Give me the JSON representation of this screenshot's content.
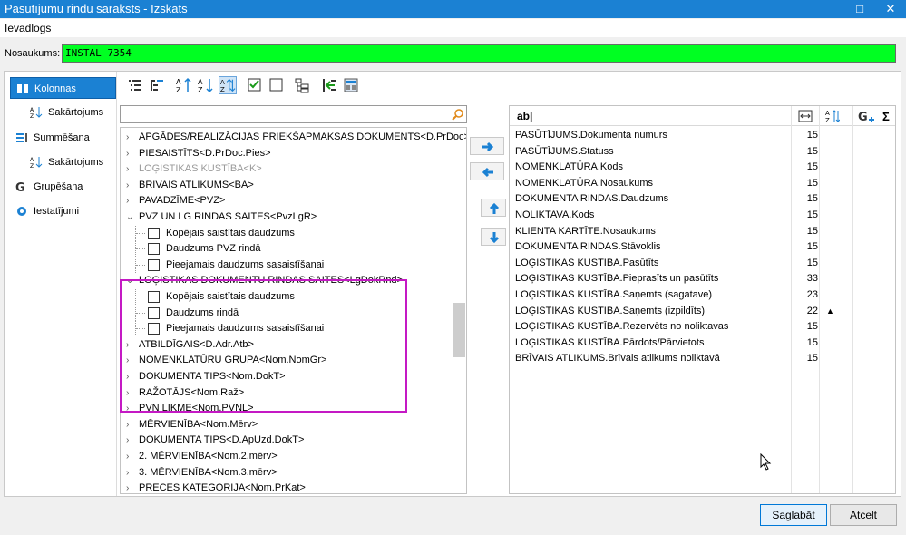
{
  "window": {
    "title": "Pasūtījumu rindu saraksts - Izskats",
    "maximize_glyph": "□",
    "close_glyph": "✕"
  },
  "menu": {
    "main": "Ievadlogs"
  },
  "name_field": {
    "label": "Nosaukums:",
    "value": "INSTAL 7354",
    "color": "#00ff22"
  },
  "sidebar": {
    "items": [
      {
        "label": "Kolonnas",
        "icon": "columns-icon",
        "active": true
      },
      {
        "label": "Sakārtojums",
        "icon": "sort-az-icon",
        "sub": true
      },
      {
        "label": "Summēšana",
        "icon": "sum-icon"
      },
      {
        "label": "Sakārtojums",
        "icon": "sort-az-icon",
        "sub": true
      },
      {
        "label": "Grupēšana",
        "icon": "group-icon"
      },
      {
        "label": "Iestatījumi",
        "icon": "gear-icon"
      }
    ]
  },
  "search": {
    "value": "",
    "placeholder": ""
  },
  "tree": {
    "rows": [
      {
        "label": "APGĀDES/REALIZĀCIJAS PRIEKŠAPMAKSAS DOKUMENTS<D.PrDoc>",
        "type": "group",
        "expanded": false
      },
      {
        "label": "PIESAISTĪTS<D.PrDoc.Pies>",
        "type": "group",
        "expanded": false
      },
      {
        "label": "LOĢISTIKAS KUSTĪBA<K>",
        "type": "group",
        "expanded": false,
        "disabled": true
      },
      {
        "label": "BRĪVAIS ATLIKUMS<BA>",
        "type": "group",
        "expanded": false
      },
      {
        "label": "PAVADZĪME<PVZ>",
        "type": "group",
        "expanded": false
      },
      {
        "label": "PVZ UN LG RINDAS SAITES<PvzLgR>",
        "type": "group",
        "expanded": true
      },
      {
        "label": "Kopējais saistītais daudzums",
        "type": "child"
      },
      {
        "label": "Daudzums PVZ rindā",
        "type": "child"
      },
      {
        "label": "Pieejamais daudzums sasaistīšanai",
        "type": "child"
      },
      {
        "label": "LOĢISTIKAS DOKUMENTU RINDAS SAITES<LgDokRnd>",
        "type": "group",
        "expanded": true
      },
      {
        "label": "Kopējais saistītais daudzums",
        "type": "child"
      },
      {
        "label": "Daudzums rindā",
        "type": "child"
      },
      {
        "label": "Pieejamais daudzums sasaistīšanai",
        "type": "child"
      },
      {
        "label": "ATBILDĪGAIS<D.Adr.Atb>",
        "type": "group",
        "expanded": false
      },
      {
        "label": "NOMENKLATŪRU GRUPA<Nom.NomGr>",
        "type": "group",
        "expanded": false
      },
      {
        "label": "DOKUMENTA TIPS<Nom.DokT>",
        "type": "group",
        "expanded": false
      },
      {
        "label": "RAŽOTĀJS<Nom.Raž>",
        "type": "group",
        "expanded": false
      },
      {
        "label": "PVN LIKME<Nom.PVNL>",
        "type": "group",
        "expanded": false
      },
      {
        "label": "MĒRVIENĪBA<Nom.Mērv>",
        "type": "group",
        "expanded": false
      },
      {
        "label": "DOKUMENTA TIPS<D.ApUzd.DokT>",
        "type": "group",
        "expanded": false
      },
      {
        "label": "2. MĒRVIENĪBA<Nom.2.mērv>",
        "type": "group",
        "expanded": false
      },
      {
        "label": "3. MĒRVIENĪBA<Nom.3.mērv>",
        "type": "group",
        "expanded": false
      },
      {
        "label": "PRECES KATEGORIJA<Nom.PrKat>",
        "type": "group",
        "expanded": false
      }
    ]
  },
  "columns_header": {
    "name": "ab|",
    "length_icon": "width-icon",
    "sort_icon": "sort-az-icon",
    "group_icon": "group-add-icon",
    "sum_glyph": "Σ"
  },
  "columns": [
    {
      "name": "PASŪTĪJUMS.Dokumenta numurs",
      "len": "15"
    },
    {
      "name": "PASŪTĪJUMS.Statuss",
      "len": "15"
    },
    {
      "name": "NOMENKLATŪRA.Kods",
      "len": "15"
    },
    {
      "name": "NOMENKLATŪRA.Nosaukums",
      "len": "15"
    },
    {
      "name": "DOKUMENTA RINDAS.Daudzums",
      "len": "15"
    },
    {
      "name": "NOLIKTAVA.Kods",
      "len": "15"
    },
    {
      "name": "KLIENTA KARTĪTE.Nosaukums",
      "len": "15"
    },
    {
      "name": "DOKUMENTA RINDAS.Stāvoklis",
      "len": "15"
    },
    {
      "name": "LOĢISTIKAS KUSTĪBA.Pasūtīts",
      "len": "15"
    },
    {
      "name": "LOĢISTIKAS KUSTĪBA.Pieprasīts un pasūtīts",
      "len": "33"
    },
    {
      "name": "LOĢISTIKAS KUSTĪBA.Saņemts (sagatave)",
      "len": "23"
    },
    {
      "name": "LOĢISTIKAS KUSTĪBA.Saņemts (izpildīts)",
      "len": "22",
      "sort": "▲"
    },
    {
      "name": "LOĢISTIKAS KUSTĪBA.Rezervēts no noliktavas",
      "len": "15"
    },
    {
      "name": "LOĢISTIKAS KUSTĪBA.Pārdots/Pārvietots",
      "len": "15"
    },
    {
      "name": "BRĪVAIS ATLIKUMS.Brīvais atlikums noliktavā",
      "len": "15"
    }
  ],
  "footer": {
    "save_label": "Saglabāt",
    "cancel_label": "Atcelt"
  },
  "colors": {
    "accent": "#1b81d3",
    "highlight_border": "#c419c4"
  }
}
